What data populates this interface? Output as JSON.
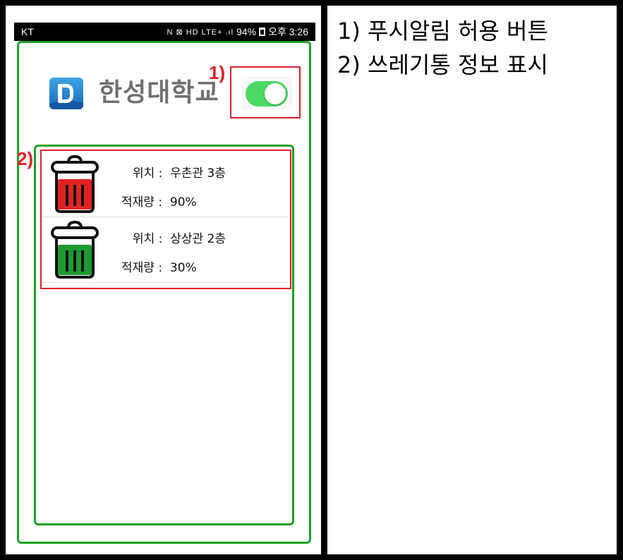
{
  "status_bar": {
    "carrier": "KT",
    "icons": "N ⊠ HD LTE+ .ıl",
    "battery": "94%",
    "time": "오후 3:26"
  },
  "app": {
    "university_name": "한성대학교",
    "push_toggle_on": true
  },
  "markers": {
    "m1": "1)",
    "m2": "2)"
  },
  "bins": [
    {
      "location_label": "위치 :",
      "location": "우촌관 3층",
      "fill_label": "적재량 :",
      "fill": "90%",
      "fill_color": "#e02222"
    },
    {
      "location_label": "위치 :",
      "location": "상상관 2층",
      "fill_label": "적재량 :",
      "fill": "30%",
      "fill_color": "#1f9a32"
    }
  ],
  "legend": {
    "item1": "1)  푸시알림 허용 버튼",
    "item2": "2)  쓰레기통 정보 표시"
  },
  "colors": {
    "frame_green": "#1fa125",
    "annotation_red": "#e0202b",
    "toggle_green": "#4cd964"
  }
}
